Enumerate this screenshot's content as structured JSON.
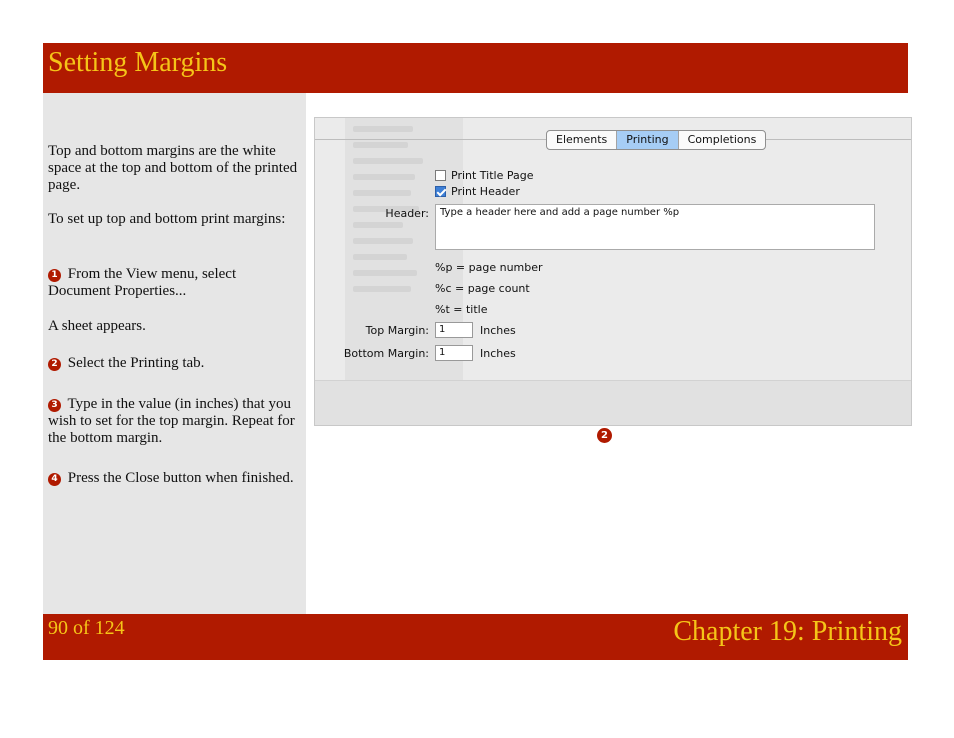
{
  "title": "Setting Margins",
  "left_panel": {
    "p1": "Top and bottom margins are the white space at the top and bottom of the printed page.",
    "p2": "To set up top and bottom print margins:",
    "step1_num": "1",
    "step1": "From the View menu, select Document Properties...",
    "p3": "A sheet appears.",
    "step2_num": "2",
    "step2": "Select the Printing tab.",
    "step3_num": "3",
    "step3": "Type in the value (in inches) that you wish to set for the top margin. Repeat for the bottom margin.",
    "step4_num": "4",
    "step4": "Press the Close button when finished."
  },
  "footer": {
    "page": "90 of 124",
    "chapter": "Chapter 19: Printing"
  },
  "dialog": {
    "tabs": [
      "Elements",
      "Printing",
      "Completions"
    ],
    "selected_tab": "Printing",
    "print_title_page": "Print Title Page",
    "print_header": "Print Header",
    "header_label": "Header:",
    "header_value": "Type a header here and add a page number %p",
    "info_page": "%p = page number",
    "info_count": "%c = page count",
    "info_title": "%t = title",
    "top_margin_label": "Top Margin:",
    "top_margin_value": "1",
    "top_margin_unit": "Inches",
    "bottom_margin_label": "Bottom Margin:",
    "bottom_margin_value": "1",
    "bottom_margin_unit": "Inches"
  },
  "callout": "2",
  "colors": {
    "brand_red": "#b01a00",
    "brand_gold": "#f5c518",
    "tab_selected": "#a6cdf5"
  }
}
